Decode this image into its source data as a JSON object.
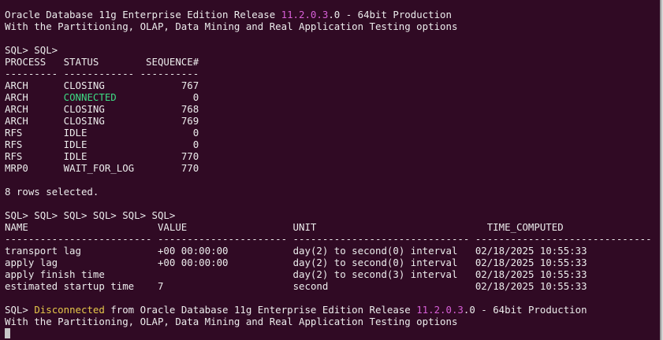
{
  "banner": {
    "line1_prefix": "Oracle Database 11g Enterprise Edition Release ",
    "line1_version_major": "11.2.0.3",
    "line1_suffix": ".0 - 64bit Production",
    "line2": "With the Partitioning, OLAP, Data Mining and Real Application Testing options"
  },
  "query1": {
    "prompt": "SQL> SQL>",
    "header": "PROCESS   STATUS        SEQUENCE#",
    "separator": "--------- ------------ ----------",
    "rows": [
      {
        "process": "ARCH",
        "status": "CLOSING",
        "sequence": "767",
        "status_color": "default"
      },
      {
        "process": "ARCH",
        "status": "CONNECTED",
        "sequence": "0",
        "status_color": "green"
      },
      {
        "process": "ARCH",
        "status": "CLOSING",
        "sequence": "768",
        "status_color": "default"
      },
      {
        "process": "ARCH",
        "status": "CLOSING",
        "sequence": "769",
        "status_color": "default"
      },
      {
        "process": "RFS",
        "status": "IDLE",
        "sequence": "0",
        "status_color": "default"
      },
      {
        "process": "RFS",
        "status": "IDLE",
        "sequence": "0",
        "status_color": "default"
      },
      {
        "process": "RFS",
        "status": "IDLE",
        "sequence": "770",
        "status_color": "default"
      },
      {
        "process": "MRP0",
        "status": "WAIT_FOR_LOG",
        "sequence": "770",
        "status_color": "default"
      }
    ],
    "footer": "8 rows selected."
  },
  "query2": {
    "prompt": "SQL> SQL> SQL> SQL> SQL> SQL>",
    "header": "NAME                      VALUE                  UNIT                             TIME_COMPUTED",
    "separator": "------------------------- ---------------------- ------------------------------ ------------------------------",
    "rows": [
      {
        "name": "transport lag",
        "value": "+00 00:00:00",
        "unit": "day(2) to second(0) interval",
        "time": "02/18/2025 10:55:33"
      },
      {
        "name": "apply lag",
        "value": "+00 00:00:00",
        "unit": "day(2) to second(0) interval",
        "time": "02/18/2025 10:55:33"
      },
      {
        "name": "apply finish time",
        "value": "",
        "unit": "day(2) to second(3) interval",
        "time": "02/18/2025 10:55:33"
      },
      {
        "name": "estimated startup time",
        "value": "7",
        "unit": "second",
        "time": "02/18/2025 10:55:33"
      }
    ]
  },
  "exit": {
    "prompt": "SQL> ",
    "disconnected": "Disconnected",
    "line1_mid": " from Oracle Database 11g Enterprise Edition Release ",
    "line1_version_major": "11.2.0.3",
    "line1_suffix": ".0 - 64bit Production",
    "line2": "With the Partitioning, OLAP, Data Mining and Real Application Testing options"
  },
  "colors": {
    "background": "#300a24",
    "text": "#ececec",
    "version": "#d75fd7",
    "connected": "#3ddc84",
    "disconnected": "#e6c84a"
  }
}
